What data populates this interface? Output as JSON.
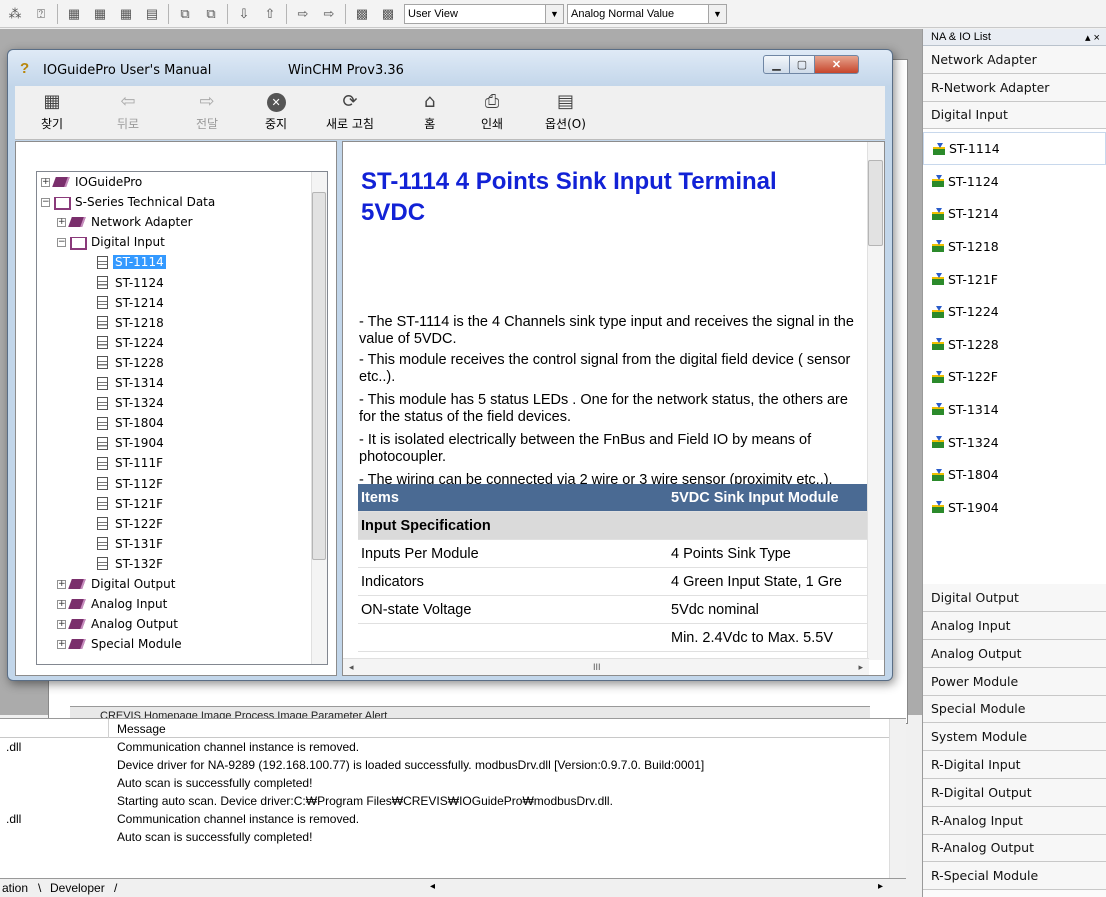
{
  "toolbar": {
    "user_view": "User View",
    "analog_value": "Analog Normal Value"
  },
  "chm": {
    "title": "IOGuidePro User's Manual",
    "subtitle": "WinCHM Prov3.36",
    "tools": [
      {
        "label": "찾기"
      },
      {
        "label": "뒤로"
      },
      {
        "label": "전달"
      },
      {
        "label": "중지"
      },
      {
        "label": "새로 고침"
      },
      {
        "label": "홈"
      },
      {
        "label": "인쇄"
      },
      {
        "label": "옵션(O)"
      }
    ],
    "tree": {
      "root": "IOGuidePro",
      "series": "S-Series Technical Data",
      "network_adapter": "Network Adapter",
      "digital_input": "Digital Input",
      "modules": [
        "ST-1114",
        "ST-1124",
        "ST-1214",
        "ST-1218",
        "ST-1224",
        "ST-1228",
        "ST-1314",
        "ST-1324",
        "ST-1804",
        "ST-1904",
        "ST-111F",
        "ST-112F",
        "ST-121F",
        "ST-122F",
        "ST-131F",
        "ST-132F"
      ],
      "after": [
        "Digital Output",
        "Analog Input",
        "Analog Output",
        "Special Module"
      ]
    },
    "content": {
      "title": "ST-1114   4 Points Sink Input Terminal 5VDC",
      "para1": "- The ST-1114 is the 4 Channels sink type input and receives the signal in the value of 5VDC.",
      "para2": "- This module receives the control signal from the digital field device ( sensor etc..).",
      "para3": "- This module has 5 status LEDs . One for the network status, the others are for the status of the field devices.",
      "para4": "- It is isolated electrically between the FnBus and Field IO by means of photocoupler.",
      "para5": "- The wiring can be connected via 2 wire or 3 wire sensor (proximity etc..).",
      "table_head_items": "Items",
      "table_head_value": "5VDC Sink Input Module",
      "table_group": "Input Specification",
      "rows": [
        {
          "k": "Inputs Per Module",
          "v": "4 Points Sink Type"
        },
        {
          "k": "Indicators",
          "v": "4 Green Input State, 1 Gre"
        },
        {
          "k": "ON-state Voltage",
          "v": "5Vdc nominal"
        },
        {
          "k": "",
          "v": "Min. 2.4Vdc to Max. 5.5V"
        }
      ]
    }
  },
  "side": {
    "header": "NA & IO List",
    "top_categories": [
      "Network Adapter",
      "R-Network Adapter",
      "Digital Input"
    ],
    "modules": [
      "ST-1114",
      "ST-1124",
      "ST-1214",
      "ST-1218",
      "ST-121F",
      "ST-1224",
      "ST-1228",
      "ST-122F",
      "ST-1314",
      "ST-1324",
      "ST-1804",
      "ST-1904"
    ],
    "bottom_categories": [
      "Digital Output",
      "Analog Input",
      "Analog Output",
      "Power Module",
      "Special Module",
      "System Module",
      "R-Digital Input",
      "R-Digital Output",
      "R-Analog Input",
      "R-Analog Output",
      "R-Special Module"
    ]
  },
  "log": {
    "header": "Message",
    "rows": [
      {
        "src": ".dll",
        "msg": "Communication channel instance is removed."
      },
      {
        "src": "",
        "msg": "Device driver for NA-9289 (192.168.100.77) is loaded successfully. modbusDrv.dll [Version:0.9.7.0. Build:0001]"
      },
      {
        "src": "",
        "msg": "Auto scan is successfully completed!"
      },
      {
        "src": "",
        "msg": "Starting auto scan. Device driver:C:₩Program Files₩CREVIS₩IOGuidePro₩modbusDrv.dll."
      },
      {
        "src": ".dll",
        "msg": "Communication channel instance is removed."
      },
      {
        "src": "",
        "msg": "Auto scan is successfully completed!"
      }
    ],
    "tab_left": "ation",
    "tab_developer": "Developer"
  },
  "bottom_tabs": "CREVIS Homepage  Image  Process Image  Parameter  Alert"
}
